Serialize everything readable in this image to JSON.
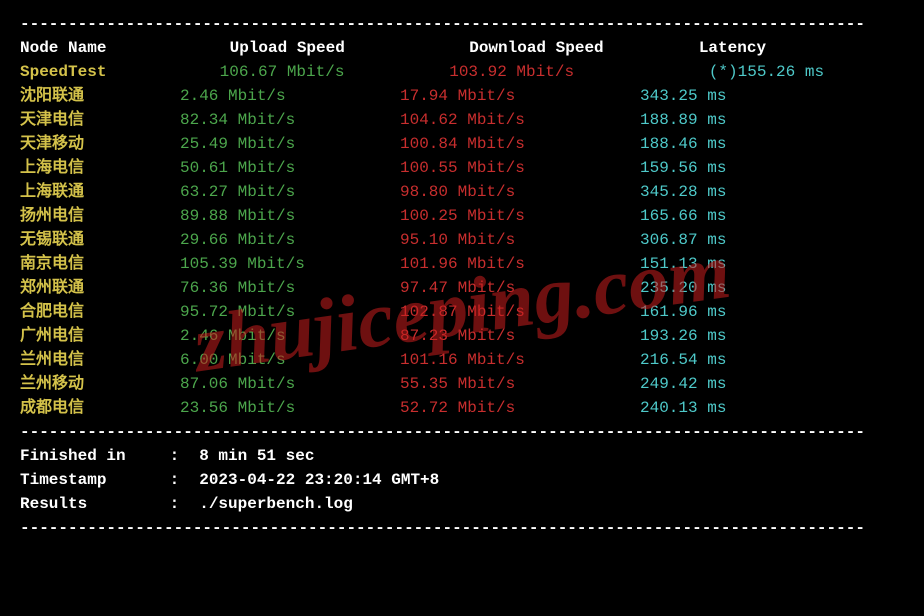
{
  "headers": {
    "node": "Node Name",
    "upload": "Upload Speed",
    "download": "Download Speed",
    "latency": "Latency"
  },
  "speedtest": {
    "name": "SpeedTest",
    "upload": "106.67 Mbit/s",
    "download": "103.92 Mbit/s",
    "latency": "(*)155.26 ms"
  },
  "rows": [
    {
      "name": "沈阳联通",
      "upload": "2.46 Mbit/s",
      "download": "17.94 Mbit/s",
      "latency": "343.25 ms"
    },
    {
      "name": "天津电信",
      "upload": "82.34 Mbit/s",
      "download": "104.62 Mbit/s",
      "latency": "188.89 ms"
    },
    {
      "name": "天津移动",
      "upload": "25.49 Mbit/s",
      "download": "100.84 Mbit/s",
      "latency": "188.46 ms"
    },
    {
      "name": "上海电信",
      "upload": "50.61 Mbit/s",
      "download": "100.55 Mbit/s",
      "latency": "159.56 ms"
    },
    {
      "name": "上海联通",
      "upload": "63.27 Mbit/s",
      "download": "98.80 Mbit/s",
      "latency": "345.28 ms"
    },
    {
      "name": "扬州电信",
      "upload": "89.88 Mbit/s",
      "download": "100.25 Mbit/s",
      "latency": "165.66 ms"
    },
    {
      "name": "无锡联通",
      "upload": "29.66 Mbit/s",
      "download": "95.10 Mbit/s",
      "latency": "306.87 ms"
    },
    {
      "name": "南京电信",
      "upload": "105.39 Mbit/s",
      "download": "101.96 Mbit/s",
      "latency": "151.13 ms"
    },
    {
      "name": "郑州联通",
      "upload": "76.36 Mbit/s",
      "download": "97.47 Mbit/s",
      "latency": "235.20 ms"
    },
    {
      "name": "合肥电信",
      "upload": "95.72 Mbit/s",
      "download": "102.87 Mbit/s",
      "latency": "161.96 ms"
    },
    {
      "name": "广州电信",
      "upload": "2.46 Mbit/s",
      "download": "87.23 Mbit/s",
      "latency": "193.26 ms"
    },
    {
      "name": "兰州电信",
      "upload": "6.00 Mbit/s",
      "download": "101.16 Mbit/s",
      "latency": "216.54 ms"
    },
    {
      "name": "兰州移动",
      "upload": "87.06 Mbit/s",
      "download": "55.35 Mbit/s",
      "latency": "249.42 ms"
    },
    {
      "name": "成都电信",
      "upload": "23.56 Mbit/s",
      "download": "52.72 Mbit/s",
      "latency": "240.13 ms"
    }
  ],
  "footer": {
    "finished_label": "Finished in",
    "finished_value": "8 min 51 sec",
    "timestamp_label": "Timestamp",
    "timestamp_value": "2023-04-22 23:20:14 GMT+8",
    "results_label": "Results",
    "results_value": "./superbench.log"
  },
  "dashes": "----------------------------------------------------------------------------------------",
  "watermark": "zhujiceping.com",
  "chart_data": {
    "type": "table",
    "title": "Network Speed Test Results",
    "columns": [
      "Node Name",
      "Upload Speed (Mbit/s)",
      "Download Speed (Mbit/s)",
      "Latency (ms)"
    ],
    "rows": [
      [
        "SpeedTest",
        106.67,
        103.92,
        155.26
      ],
      [
        "沈阳联通",
        2.46,
        17.94,
        343.25
      ],
      [
        "天津电信",
        82.34,
        104.62,
        188.89
      ],
      [
        "天津移动",
        25.49,
        100.84,
        188.46
      ],
      [
        "上海电信",
        50.61,
        100.55,
        159.56
      ],
      [
        "上海联通",
        63.27,
        98.8,
        345.28
      ],
      [
        "扬州电信",
        89.88,
        100.25,
        165.66
      ],
      [
        "无锡联通",
        29.66,
        95.1,
        306.87
      ],
      [
        "南京电信",
        105.39,
        101.96,
        151.13
      ],
      [
        "郑州联通",
        76.36,
        97.47,
        235.2
      ],
      [
        "合肥电信",
        95.72,
        102.87,
        161.96
      ],
      [
        "广州电信",
        2.46,
        87.23,
        193.26
      ],
      [
        "兰州电信",
        6.0,
        101.16,
        216.54
      ],
      [
        "兰州移动",
        87.06,
        55.35,
        249.42
      ],
      [
        "成都电信",
        23.56,
        52.72,
        240.13
      ]
    ]
  }
}
